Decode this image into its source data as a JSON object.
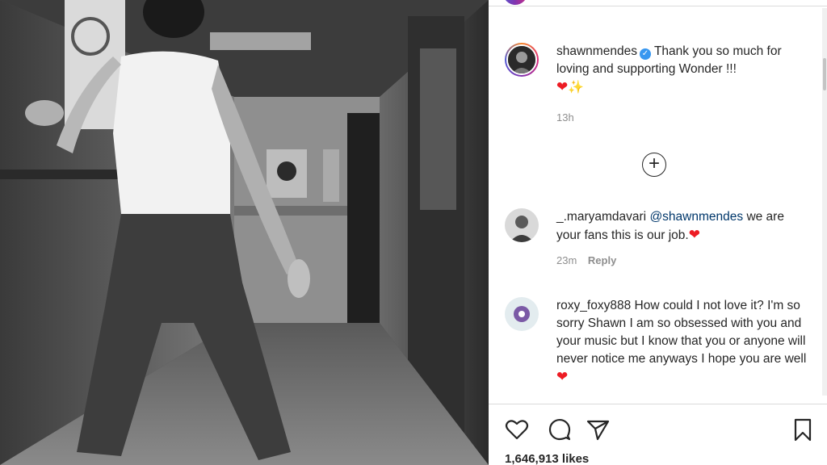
{
  "post": {
    "caption": {
      "username": "shawnmendes",
      "text": "Thank you so much for loving and supporting Wonder !!!",
      "time": "13h",
      "avatar_icon": "profile-avatar"
    },
    "load_more_icon": "plus-circle-icon",
    "comments": [
      {
        "username": "_.maryamdavari",
        "mention": "@shawnmendes",
        "text": "we are your fans this is our job.",
        "time": "23m",
        "reply_label": "Reply"
      },
      {
        "username": "roxy_foxy888",
        "text": "How could I not love it? I'm so sorry Shawn I am so obsessed with you and your music but I know that you or anyone will never notice me anyways I hope you are well"
      }
    ],
    "actions": {
      "like_icon": "heart-icon",
      "comment_icon": "comment-icon",
      "share_icon": "paper-plane-icon",
      "save_icon": "bookmark-icon"
    },
    "likes": "1,646,913 likes"
  },
  "colors": {
    "verified": "#3897f0",
    "heart": "#ed1c24",
    "mention": "#00376b",
    "meta": "#8e8e8e"
  }
}
